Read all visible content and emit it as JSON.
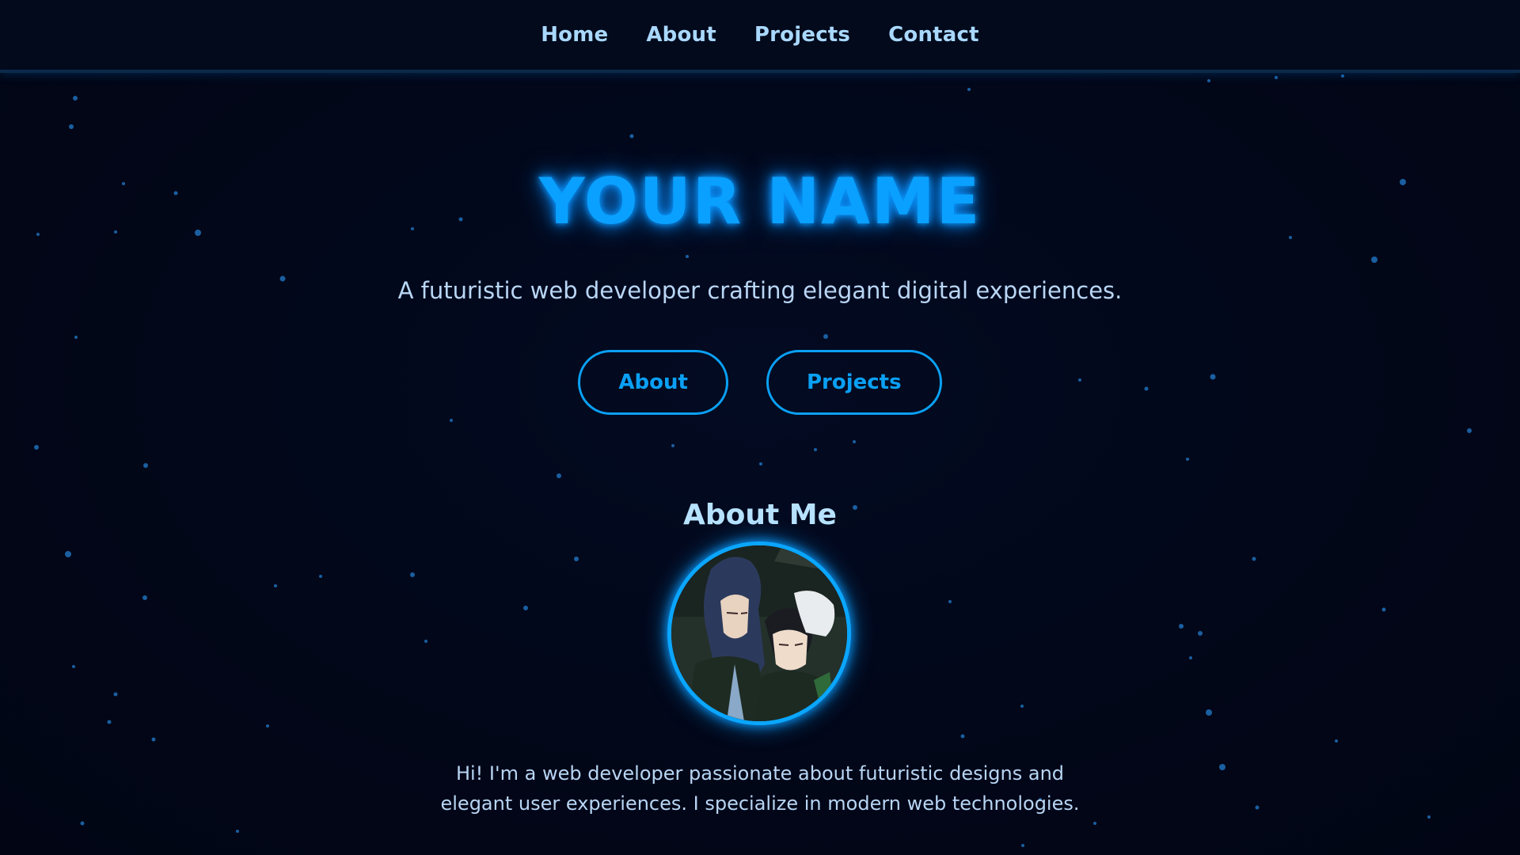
{
  "nav": {
    "links": [
      "Home",
      "About",
      "Projects",
      "Contact"
    ]
  },
  "hero": {
    "title": "YOUR NAME",
    "subtitle": "A futuristic web developer crafting elegant digital experiences.",
    "buttons": [
      "About",
      "Projects"
    ]
  },
  "about": {
    "heading": "About Me",
    "avatar_icon": "anime-characters-avatar",
    "text": "Hi! I'm a web developer passionate about futuristic designs and elegant user experiences. I specialize in modern web technologies."
  },
  "colors": {
    "background": "#010617",
    "accent": "#0aa0ff",
    "nav_text": "#a9d8ff",
    "body_text": "#b8d5f3"
  }
}
